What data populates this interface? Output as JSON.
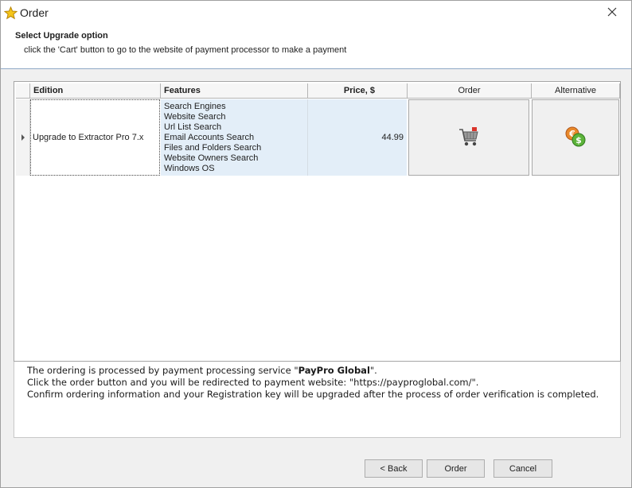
{
  "window": {
    "title": "Order"
  },
  "header": {
    "title": "Select Upgrade option",
    "subtitle": "click the 'Cart' button to go to the website of payment processor to make a payment"
  },
  "grid": {
    "columns": [
      "Edition",
      "Features",
      "Price, $",
      "Order",
      "Alternative"
    ],
    "rows": [
      {
        "edition": "Upgrade to Extractor Pro 7.x",
        "features": [
          "Search Engines",
          "Website Search",
          "Url List Search",
          "Email Accounts Search",
          "Files and Folders Search",
          "Website Owners Search",
          "Windows OS"
        ],
        "price": "44.99",
        "order_icon": "shopping-cart-icon",
        "alternative_icon": "currency-coins-icon"
      }
    ]
  },
  "info": {
    "line1_prefix": "The ordering is processed by payment processing service \"",
    "line1_bold": "PayPro Global",
    "line1_suffix": "\".",
    "line2": "Click the order button and you will be redirected to payment website: \"https://payproglobal.com/\".",
    "line3": "Confirm ordering information and your Registration key will be upgraded after the process of order verification is completed."
  },
  "footer": {
    "back_label": "< Back",
    "order_label": "Order",
    "cancel_label": "Cancel"
  },
  "colors": {
    "selected_cell_bg": "#e3eef8",
    "header_border": "#8fa9c6",
    "star_fill": "#f5c518"
  },
  "icons": {
    "title": "star-icon",
    "close": "close-icon",
    "row_indicator": "row-pointer-icon"
  }
}
